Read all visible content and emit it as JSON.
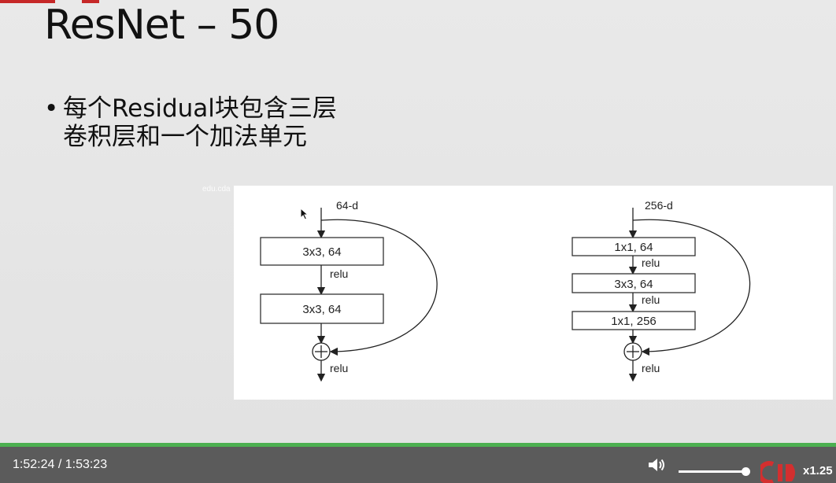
{
  "slide": {
    "title": "ResNet – 50",
    "bullet": "每个Residual块包含三层卷积层和一个加法单元",
    "watermark": "edu.cda"
  },
  "figure": {
    "left_block": {
      "input_label": "64-d",
      "layers": [
        "3x3, 64",
        "3x3, 64"
      ],
      "relu_labels": [
        "relu",
        "relu"
      ],
      "add_symbol": "+"
    },
    "right_block": {
      "input_label": "256-d",
      "layers": [
        "1x1, 64",
        "3x3, 64",
        "1x1, 256"
      ],
      "relu_labels": [
        "relu",
        "relu",
        "relu"
      ],
      "add_symbol": "+"
    }
  },
  "player": {
    "time_display": "1:52:24 / 1:53:23",
    "volume_icon": "speaker-icon",
    "volume_level": 0.9,
    "playback_progress": 0.99,
    "speed_label": "x1.25",
    "accent_color": "#4caf50"
  }
}
